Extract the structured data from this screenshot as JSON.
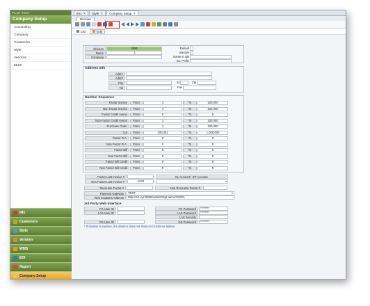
{
  "sidebar": {
    "top_label": "PILOT TEST",
    "title": "Company Setup",
    "items": [
      "Accounting",
      "Company",
      "Customers",
      "Style",
      "Vendors",
      "MISC"
    ],
    "modules": [
      "841",
      "Customers",
      "Style",
      "Vendors",
      "WMS",
      "EDI",
      "Report",
      "Company Setup"
    ],
    "module_colors": [
      "#d23b2b",
      "#c8a21c",
      "#6a8ccf",
      "#d28c2c",
      "#e6a020",
      "#3b72c2",
      "#d24a32",
      "#f1c35a"
    ],
    "active_module": "Company Setup"
  },
  "tabs": [
    {
      "label": "841"
    },
    {
      "label": "Style"
    },
    {
      "label": "Company Setup"
    }
  ],
  "subtab": "Division",
  "modes": {
    "list": "List",
    "edit": "Edit"
  },
  "form": {
    "division_label": "Division",
    "division_value": "BBB",
    "name_label": "Name",
    "name_value": "1",
    "company_label": "Company",
    "default_label": "Default",
    "inactive_label": "Inactive",
    "name_in_qb_label": "Name in QB",
    "inv_prefix_label": "Inv. Prefix",
    "address_title": "Address Info",
    "addr1_label": "Addr1",
    "addr2_label": "Addr2",
    "city_label": "City",
    "st_label": "St",
    "zip_label": "Zip",
    "tel_label": "Tel",
    "fax_label": "Fax",
    "number_title": "Number Sequence",
    "from_label": "From",
    "to_label": "To",
    "sequences": [
      {
        "name": "Factor Invoice",
        "from": "1",
        "to": "100,000"
      },
      {
        "name": "Non Factor Invoice",
        "from": "1",
        "to": "100,000"
      },
      {
        "name": "Factor Credit memo",
        "from": "0",
        "to": "0"
      },
      {
        "name": "Non Factor Credit memo",
        "from": "1",
        "to": "100,000"
      },
      {
        "name": "Purchase Order",
        "from": "1",
        "to": "100,000"
      },
      {
        "name": "Cut",
        "from": "100,001",
        "to": "1,000,000"
      },
      {
        "name": "Factor R.A.",
        "from": "0",
        "to": "0"
      },
      {
        "name": "Non Factor R.A.",
        "from": "0",
        "to": "0"
      },
      {
        "name": "Factor Bill",
        "from": "0",
        "to": "0"
      },
      {
        "name": "Non Factor Bill",
        "from": "0",
        "to": "0"
      },
      {
        "name": "Factor Bill Credit",
        "from": "0",
        "to": "0"
      },
      {
        "name": "Non Factor Bill Credit",
        "from": "0",
        "to": "0"
      }
    ],
    "factor_last_inv_label": "Factor Last Invoice #",
    "non_factor_last_inv_label": "Non Factor Last Invoice #",
    "non_factor_last_inv_value": "1242",
    "gl_account_label": "GL Account / GP Account",
    "recourse_label": "Recourse Factor #",
    "non_recourse_label": "Non Recourse Factor #",
    "payment_gateway_label": "Payment Gateway",
    "payment_gateway_value": "TEST",
    "web_endpoint_label": "Web Endpoint Address",
    "web_endpoint_value": "http://m1.xyz:9090/webinf/lmgt.asmx?WSDL",
    "third_party_title": "3rd Party Web Interface",
    "fg_user_label": "FG User ID",
    "las_user_label": "LAS User ID",
    "fg_password_label": "FG Password",
    "las_password_label": "LAS Password",
    "las_security_label": "LAS Security",
    "os_user_label": "OS User ID",
    "os_password_label": "OS Password",
    "password_mask": "********",
    "note": "* If division is inactive, the division does not show on Customer Master"
  }
}
